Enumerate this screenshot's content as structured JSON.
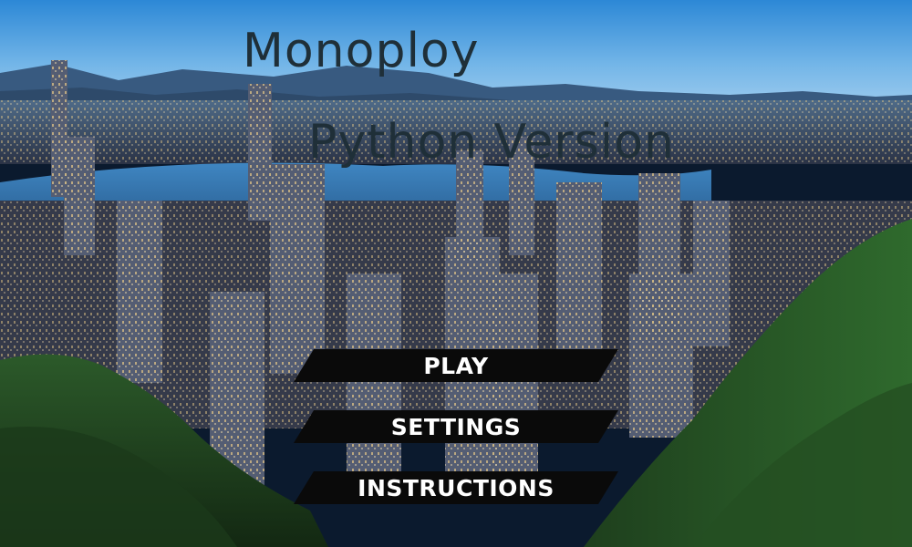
{
  "game": {
    "title_line_1": "Monoploy",
    "title_line_2": "Python Version"
  },
  "menu": {
    "play_label": "PLAY",
    "settings_label": "SETTINGS",
    "instructions_label": "INSTRUCTIONS"
  },
  "colors": {
    "title": "#1f2f38",
    "button_bg": "#0a0a0a",
    "button_text": "#ffffff",
    "sky_top": "#2f8fd8",
    "harbor_water": "#3a7fb8",
    "forest": "#1d3a1c"
  },
  "background": {
    "icon": "city-skyline-icon"
  }
}
